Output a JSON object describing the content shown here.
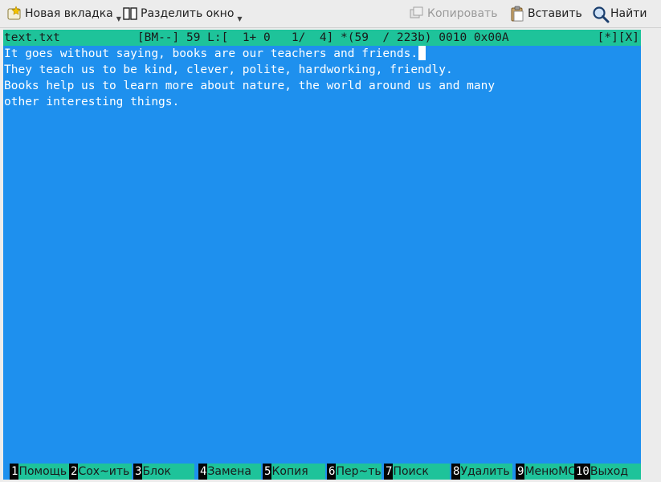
{
  "toolbar": {
    "new_tab": "Новая вкладка",
    "split": "Разделить окно",
    "copy": "Копировать",
    "paste": "Вставить",
    "find": "Найти"
  },
  "editor": {
    "filename": "text.txt",
    "status": "[BM--] 59 L:[  1+ 0   1/  4] *(59  / 223b) 0010 0x00A",
    "flags": "[*][X]",
    "lines": [
      "It goes without saying, books are our teachers and friends.",
      "They teach us to be kind, clever, polite, hardworking, friendly.",
      "Books help us to learn more about nature, the world around us and many",
      "other interesting things."
    ]
  },
  "fkeys": [
    {
      "num": "1",
      "label": "Помощь"
    },
    {
      "num": "2",
      "label": "Сох~ить"
    },
    {
      "num": "3",
      "label": "Блок"
    },
    {
      "num": "4",
      "label": "Замена"
    },
    {
      "num": "5",
      "label": "Копия"
    },
    {
      "num": "6",
      "label": "Пер~ть"
    },
    {
      "num": "7",
      "label": "Поиск"
    },
    {
      "num": "8",
      "label": "Удалить"
    },
    {
      "num": "9",
      "label": "МенюMC"
    },
    {
      "num": "10",
      "label": "Выход"
    }
  ],
  "colors": {
    "editor_bg": "#1e90ee",
    "status_bg": "#1ec39a",
    "fkey_num_bg": "#050505"
  }
}
